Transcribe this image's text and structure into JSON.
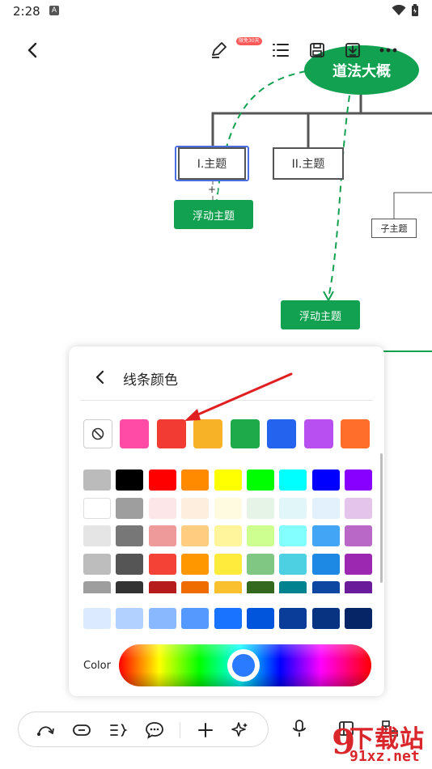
{
  "status_bar": {
    "time": "2:28",
    "indicator": "A"
  },
  "toolbar": {
    "back_icon": "chevron-left-icon",
    "badge": "限免30天",
    "icons": [
      "pen-icon",
      "outline-list-icon",
      "save-icon",
      "download-icon",
      "more-icon"
    ]
  },
  "mindmap": {
    "root": "道法大概",
    "topic1": "I.主题",
    "topic2": "II.主题",
    "float1": "浮动主题",
    "float2": "浮动主题",
    "child": "子主题",
    "add_symbol": "+",
    "accent_color": "#12a150",
    "selection_color": "#4a6ee0"
  },
  "panel": {
    "title": "线条颜色",
    "color_label": "Color",
    "spectrum_selected": "#2a7bff",
    "recent_colors": [
      "#ff4aa6",
      "#f23c33",
      "#f8b227",
      "#1ea94a",
      "#2463ee",
      "#b84ff0",
      "#ff6e2a"
    ],
    "grid": [
      [
        "#bbbbbb",
        "#000000",
        "#ff0000",
        "#ff8a00",
        "#ffff00",
        "#00ff00",
        "#00ffff",
        "#0000ff",
        "#8800ff"
      ],
      [
        "#ffffff",
        "#9e9e9e",
        "#fde6e8",
        "#fdeedd",
        "#fffbe0",
        "#e6f4e8",
        "#e0f6f8",
        "#e2f1fc",
        "#e4c4ea"
      ],
      [
        "#e5e5e5",
        "#777777",
        "#ef9a9a",
        "#ffcc80",
        "#fff59d",
        "#ccff90",
        "#84ffff",
        "#42a5f5",
        "#ba68c8"
      ],
      [
        "#bdbdbd",
        "#555555",
        "#f44336",
        "#ff9800",
        "#ffeb3b",
        "#81c784",
        "#4dd0e1",
        "#1e88e5",
        "#9c27b0"
      ],
      [
        "#9e9e9e",
        "#333333",
        "#b71c1c",
        "#ef6c00",
        "#fbc02d",
        "#33691e",
        "#00838f",
        "#0d47a1",
        "#6a1b9a"
      ]
    ],
    "blue_row": [
      "#dbeafe",
      "#b3d1ff",
      "#8ab8ff",
      "#5599ff",
      "#1a73ff",
      "#0055dd",
      "#0a3d99",
      "#073380",
      "#052566"
    ]
  },
  "bottom_bar": {
    "icons": [
      "connector-icon",
      "subtopic-icon",
      "summary-icon",
      "comment-icon",
      "add-icon",
      "ai-sparkle-icon"
    ],
    "side_icons": [
      "microphone-icon",
      "layout-icon",
      "structure-icon"
    ]
  },
  "watermark": {
    "line1": "下载站",
    "line2": "91xz.net",
    "logo": "9"
  }
}
